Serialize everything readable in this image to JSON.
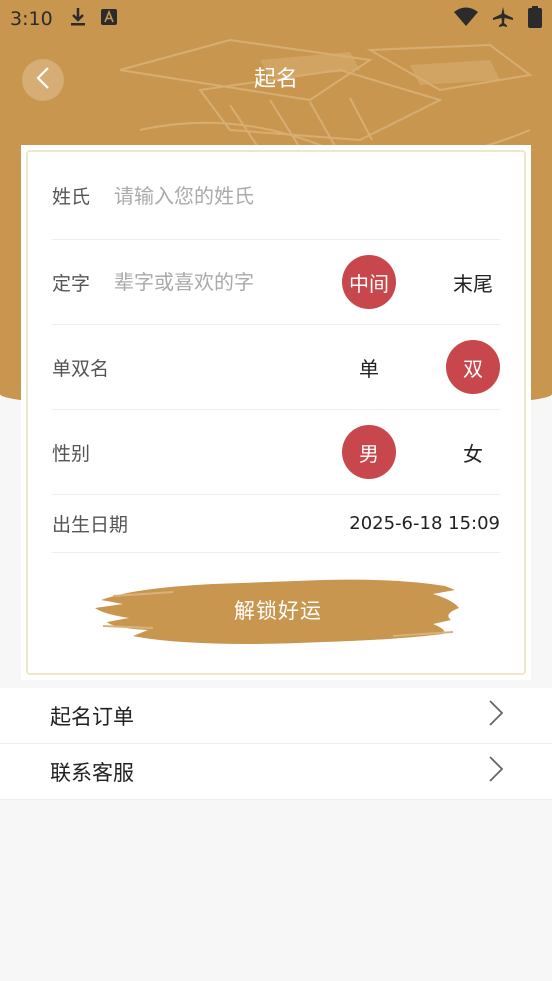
{
  "status_bar": {
    "time": "3:10",
    "left_icons": [
      "download-icon",
      "font-app-icon"
    ],
    "right_icons": [
      "wifi-icon",
      "airplane-icon",
      "battery-icon"
    ]
  },
  "header": {
    "title": "起名",
    "background_color": "#c9964f"
  },
  "form": {
    "surname": {
      "label": "姓氏",
      "value": "",
      "placeholder": "请输入您的姓氏"
    },
    "fixed_char": {
      "label": "定字",
      "value": "",
      "placeholder": "辈字或喜欢的字",
      "options": [
        "中间",
        "末尾"
      ],
      "selected": "中间"
    },
    "name_length": {
      "label": "单双名",
      "options": [
        "单",
        "双"
      ],
      "selected": "双"
    },
    "gender": {
      "label": "性别",
      "options": [
        "男",
        "女"
      ],
      "selected": "男"
    },
    "birth_date": {
      "label": "出生日期",
      "value": "2025-6-18 15:09"
    },
    "unlock_button_label": "解锁好运"
  },
  "menu": {
    "items": [
      {
        "label": "起名订单",
        "icon": "chevron-right-icon"
      },
      {
        "label": "联系客服",
        "icon": "chevron-right-icon"
      }
    ]
  },
  "colors": {
    "accent": "#c9964f",
    "selected": "#c8474c"
  }
}
